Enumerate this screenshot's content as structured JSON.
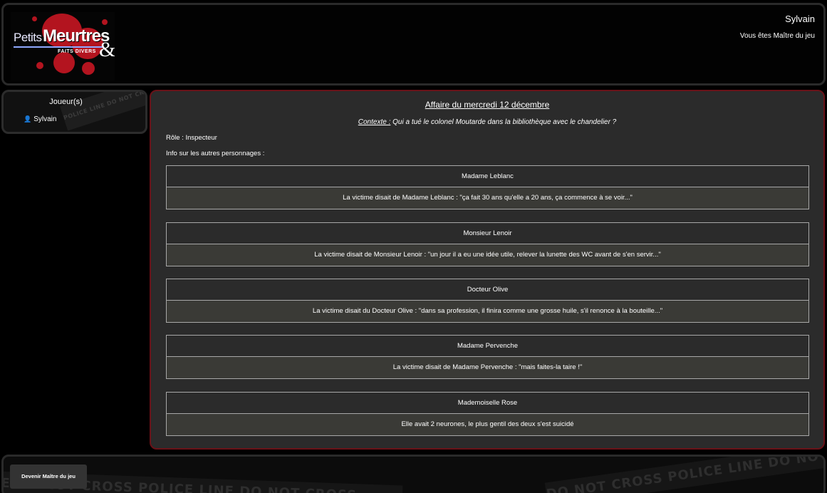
{
  "header": {
    "logo": {
      "word1": "Petits",
      "word2": "Meurtres",
      "word3": "FAITS DIVERS",
      "amp": "&"
    },
    "user_name": "Sylvain",
    "user_role": "Vous êtes Maître du jeu"
  },
  "sidebar": {
    "title": "Joueur(s)",
    "players": [
      "Sylvain"
    ],
    "tape_text": "POLICE LINE DO NOT CROSS POLICE LI"
  },
  "main": {
    "case_title": "Affaire du mercredi 12 décembre",
    "context_label": "Contexte :",
    "context_text": " Qui a tué le colonel Moutarde dans la bibliothèque avec le chandelier ?",
    "role_line": "Rôle : Inspecteur",
    "info_line": "Info sur les autres personnages :",
    "characters": [
      {
        "name": "Madame Leblanc",
        "quote": "La victime disait de Madame Leblanc : \"ça fait 30 ans qu'elle a 20 ans, ça commence à se voir...\""
      },
      {
        "name": "Monsieur Lenoir",
        "quote": "La victime disait de Monsieur Lenoir : \"un jour il a eu une idée utile, relever la lunette des WC avant de s'en servir...\""
      },
      {
        "name": "Docteur Olive",
        "quote": "La victime disait du Docteur Olive : \"dans sa profession, il finira comme une grosse huile, s'il renonce à la bouteille...\""
      },
      {
        "name": "Madame Pervenche",
        "quote": "La victime disait de Madame Pervenche : \"mais faites-la taire !\""
      },
      {
        "name": "Mademoiselle Rose",
        "quote": "Elle avait 2 neurones, le plus gentil des deux s'est suicidé"
      }
    ]
  },
  "footer": {
    "button_label": "Devenir Maître du jeu",
    "tape_left": "LINE DO NOT CROSS POLICE LINE DO NOT CROSS",
    "tape_right": "DO NOT CROSS POLICE LINE DO NOT CROSS POLICE LINE DO NOT"
  },
  "colors": {
    "accent_border": "#6a1218",
    "logo_red": "#b3141f",
    "panel": "#2b2b2b"
  }
}
